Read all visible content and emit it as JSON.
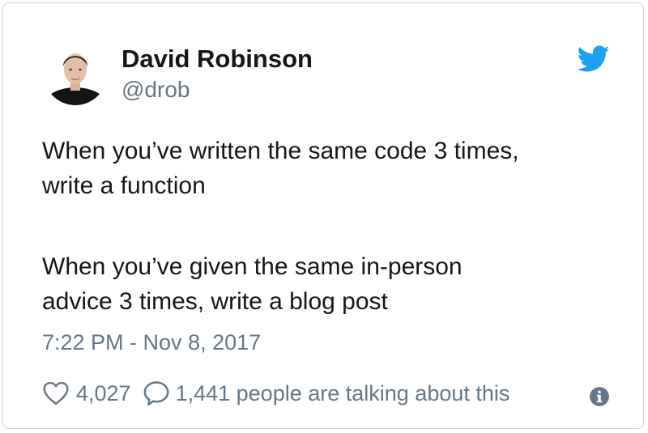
{
  "tweet": {
    "author": {
      "name": "David Robinson",
      "handle": "@drob",
      "avatar_icon": "person-avatar"
    },
    "brand_icon": "twitter-bird-icon",
    "text_paragraphs": [
      [
        "When you’ve written the same code 3 times,",
        "write a function"
      ],
      [
        "When you’ve given the same in-person",
        "advice 3 times, write a blog post"
      ]
    ],
    "timestamp": "7:22 PM - Nov 8, 2017",
    "likes_count": "4,027",
    "talking_text": "1,441 people are talking about this",
    "icons": {
      "like": "heart-icon",
      "reply": "speech-bubble-icon",
      "info": "info-icon"
    }
  },
  "colors": {
    "text_primary": "#14171a",
    "text_secondary": "#657786",
    "brand_blue": "#1da1f2",
    "border": "#c9d4de"
  }
}
